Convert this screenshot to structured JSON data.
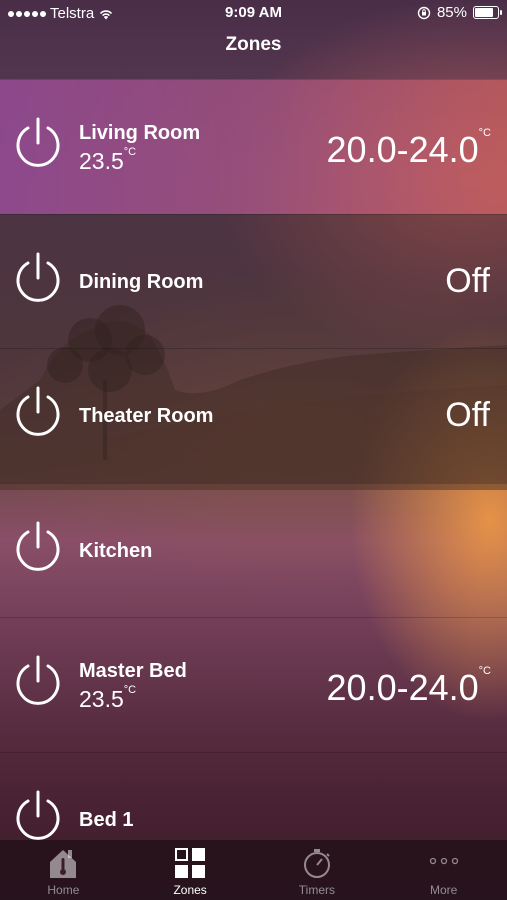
{
  "status_bar": {
    "carrier": "Telstra",
    "time": "9:09 AM",
    "battery_percent": "85%",
    "battery_level": 0.85
  },
  "nav": {
    "title": "Zones"
  },
  "zones": [
    {
      "name": "Living Room",
      "temp": "23.5",
      "temp_unit": "°C",
      "setting": "20.0-24.0",
      "setting_unit": "°C",
      "on": true
    },
    {
      "name": "Dining Room",
      "setting": "Off",
      "on": false
    },
    {
      "name": "Theater Room",
      "setting": "Off",
      "on": false
    },
    {
      "name": "Kitchen",
      "on": false
    },
    {
      "name": "Master Bed",
      "temp": "23.5",
      "temp_unit": "°C",
      "setting": "20.0-24.0",
      "setting_unit": "°C",
      "on": true
    },
    {
      "name": "Bed 1",
      "on": false
    }
  ],
  "tabbar": {
    "tabs": [
      {
        "label": "Home",
        "icon": "home-thermometer-icon",
        "selected": false
      },
      {
        "label": "Zones",
        "icon": "grid-icon",
        "selected": true
      },
      {
        "label": "Timers",
        "icon": "stopwatch-icon",
        "selected": false
      },
      {
        "label": "More",
        "icon": "more-dots-icon",
        "selected": false
      }
    ]
  },
  "colors": {
    "active_zone_start": "#964b96",
    "active_zone_end": "#c85f5f",
    "tabbar_bg": "#26121c",
    "tab_inactive": "#ffffff80"
  }
}
